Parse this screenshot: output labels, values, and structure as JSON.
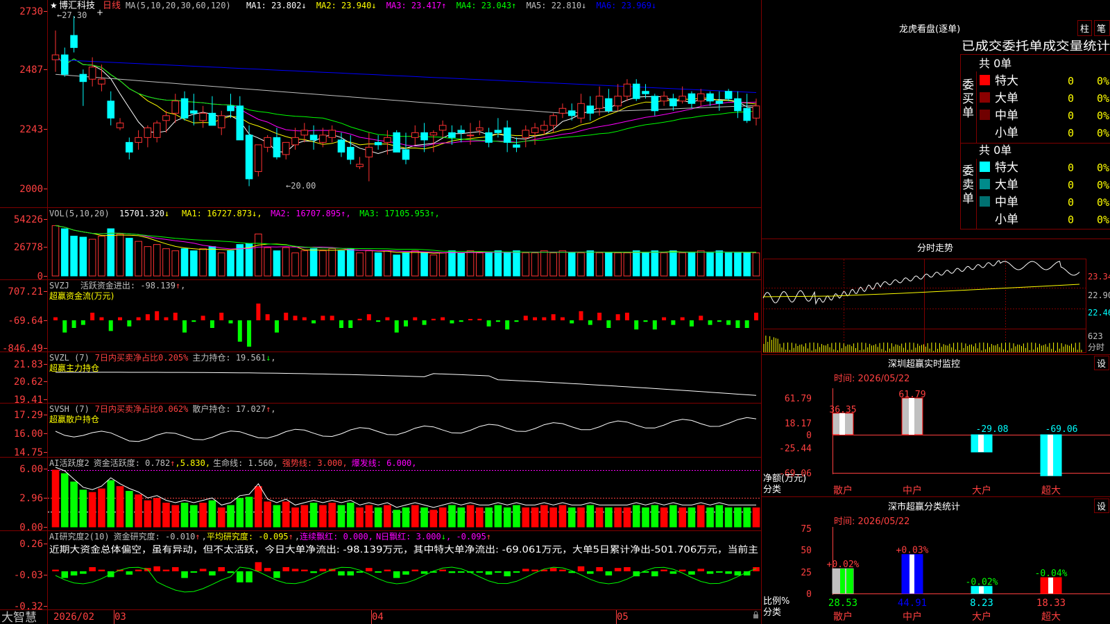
{
  "stock": {
    "name": "博汇科技",
    "period": "日线",
    "brand": "大智慧"
  },
  "main": {
    "ma_label": "MA(5,10,20,30,60,120)",
    "ma_values": [
      {
        "label": "MA1: 23.802",
        "arrow": "↓",
        "color": "#ffffff"
      },
      {
        "label": "MA2: 23.940",
        "arrow": "↓",
        "color": "#ffff00"
      },
      {
        "label": "MA3: 23.417",
        "arrow": "↑",
        "color": "#ff00ff"
      },
      {
        "label": "MA4: 23.043",
        "arrow": "↑",
        "color": "#00ff00"
      },
      {
        "label": "MA5: 22.810",
        "arrow": "↓",
        "color": "#c0c0c0"
      },
      {
        "label": "MA6: 23.969",
        "arrow": "↓",
        "color": "#0000ff"
      }
    ],
    "y_ticks": [
      "2730",
      "2487",
      "2243",
      "2000"
    ],
    "high_label": "27.30",
    "low_label": "20.00"
  },
  "vol": {
    "label": "VOL(5,10,20)",
    "value": "15701.320",
    "value_arrow": "↓",
    "ma": [
      {
        "label": "MA1: 16727.873",
        "arrow": "↓",
        "color": "#ffff00"
      },
      {
        "label": "MA2: 16707.895",
        "arrow": "↑",
        "color": "#ff00ff"
      },
      {
        "label": "MA3: 17105.953",
        "arrow": "↑",
        "color": "#00ff00"
      }
    ],
    "y_ticks": [
      "54226",
      "26778",
      "0"
    ]
  },
  "svzj": {
    "label": "SVZJ",
    "text": "活跃资金进出: -98.139",
    "arrow": "↑",
    "tail": ",",
    "sub": "超赢资金流(万元)",
    "y_ticks": [
      "707.21",
      "-69.64",
      "-846.49"
    ]
  },
  "svzl": {
    "label": "SVZL (7)",
    "ratio": "7日内买卖净占比0.205%",
    "text": "主力持仓: 19.561",
    "arrow": "↓",
    "tail": ",",
    "sub": "超赢主力持仓",
    "y_ticks": [
      "21.83",
      "20.62",
      "19.41"
    ]
  },
  "svsh": {
    "label": "SVSH (7)",
    "ratio": "7日内买卖净占比0.062%",
    "text": "散户持仓: 17.027",
    "arrow": "↑",
    "tail": ",",
    "sub": "超赢散户持仓",
    "y_ticks": [
      "17.29",
      "16.00",
      "14.75"
    ]
  },
  "ai1": {
    "label": "AI活跃度2",
    "text": "资金活跃度: 0.782",
    "a1": "↑",
    "v2": ",5.830,",
    "life": "生命线: 1.560,",
    "strong": "强势线: 3.000,",
    "burst": "爆发线: 6.000,",
    "y_ticks": [
      "6.00",
      "2.96",
      "0.00"
    ]
  },
  "ai2": {
    "label": "AI研究度2(10)",
    "text": "资金研究度: -0.010",
    "a1": "↑",
    "avg": "平均研究度: -0.095",
    "a2": "↑",
    "cont": "连续飘红: 0.000,",
    "nday": "N日飘红: 3.000",
    "a3": "↓",
    "tail": ", -0.095",
    "a4": "↑",
    "comment": "近期大资金总体偏空，虽有异动，但不太活跃，今日大单净流出: -98.139万元，其中特大单净流出: -69.061万元，大单5日累计净出-501.706万元，当前主",
    "y_ticks": [
      "0.26",
      "-0.03",
      "-0.32"
    ]
  },
  "xaxis": [
    "2026/02",
    "03",
    "04",
    "05"
  ],
  "dragon": {
    "title": "龙虎看盘(逐单)",
    "btn1": "柱",
    "btn2": "笔",
    "header": "已成交委托单成交量统计",
    "buy_label": "委买单",
    "sell_label": "委卖单",
    "buy_total": "共 0单",
    "sell_total": "共 0单",
    "buy_rows": [
      {
        "name": "特大",
        "count": "0",
        "pct": "0%",
        "color": "#ff0000"
      },
      {
        "name": "大单",
        "count": "0",
        "pct": "0%",
        "color": "#8b0000"
      },
      {
        "name": "中单",
        "count": "0",
        "pct": "0%",
        "color": "#700000"
      },
      {
        "name": "小单",
        "count": "0",
        "pct": "0%",
        "color": ""
      }
    ],
    "sell_rows": [
      {
        "name": "特大",
        "count": "0",
        "pct": "0%",
        "color": "#00ffff"
      },
      {
        "name": "大单",
        "count": "0",
        "pct": "0%",
        "color": "#008b8b"
      },
      {
        "name": "中单",
        "count": "0",
        "pct": "0%",
        "color": "#007070"
      },
      {
        "name": "小单",
        "count": "0",
        "pct": "0%",
        "color": ""
      }
    ]
  },
  "fenshi": {
    "title": "分时走势",
    "y1": "23.34",
    "y2": "22.90",
    "y3": "22.46",
    "vol": "623",
    "unit": "分时"
  },
  "sz_monitor": {
    "title": "深圳超赢实时监控",
    "btn": "设",
    "time": "时间: 2026/05/22",
    "y_ticks": [
      "61.79",
      "18.17",
      "0",
      "-25.44",
      "-69.06"
    ],
    "axis_label1": "净额(万元)",
    "axis_label2": "分类",
    "categories": [
      "散户",
      "中户",
      "大户",
      "超大"
    ],
    "values": [
      36.35,
      61.79,
      -29.08,
      -69.06
    ],
    "value_labels": [
      "36.35",
      "61.79",
      "-29.08",
      "-69.06"
    ]
  },
  "sz_class": {
    "title": "深市超赢分类统计",
    "btn": "设",
    "time": "时间: 2026/05/22",
    "y_ticks": [
      "75",
      "50",
      "25",
      "0"
    ],
    "axis_label1": "比例%",
    "axis_label2": "分类",
    "categories": [
      "散户",
      "中户",
      "大户",
      "超大"
    ],
    "values": [
      28.53,
      44.91,
      8.23,
      18.33
    ],
    "value_labels": [
      "28.53",
      "44.91",
      "8.23",
      "18.33"
    ],
    "changes": [
      "+0.02%",
      "+0.03%",
      "-0.02%",
      "-0.04%"
    ]
  },
  "chart_data": {
    "type": "candlestick",
    "ohlc": [
      [
        25.3,
        26.5,
        24.8,
        25.5
      ],
      [
        25.5,
        25.8,
        24.6,
        24.7
      ],
      [
        26.3,
        27.1,
        25.6,
        25.8
      ],
      [
        24.7,
        24.9,
        23.4,
        24.4
      ],
      [
        24.5,
        25.4,
        24.2,
        25.0
      ],
      [
        24.3,
        25.1,
        24.0,
        24.5
      ],
      [
        23.6,
        24.0,
        22.6,
        22.9
      ],
      [
        22.5,
        22.9,
        22.4,
        22.7
      ],
      [
        21.9,
        22.1,
        21.2,
        21.5
      ],
      [
        21.9,
        22.4,
        21.6,
        22.1
      ],
      [
        22.1,
        22.6,
        21.7,
        22.5
      ],
      [
        22.1,
        22.8,
        21.9,
        22.7
      ],
      [
        22.8,
        23.2,
        22.3,
        23.0
      ],
      [
        23.1,
        23.9,
        22.7,
        23.6
      ],
      [
        23.7,
        24.0,
        22.8,
        22.9
      ],
      [
        23.2,
        23.9,
        22.6,
        23.1
      ],
      [
        22.8,
        23.4,
        22.5,
        23.1
      ],
      [
        23.1,
        23.8,
        22.7,
        22.6
      ],
      [
        22.5,
        23.2,
        22.2,
        23.0
      ],
      [
        23.4,
        23.9,
        22.9,
        23.2
      ],
      [
        23.4,
        23.8,
        22.0,
        22.0
      ],
      [
        22.2,
        22.6,
        20.1,
        20.4
      ],
      [
        20.7,
        21.8,
        20.5,
        21.8
      ],
      [
        21.7,
        22.2,
        21.5,
        22.1
      ],
      [
        22.1,
        22.5,
        21.2,
        21.3
      ],
      [
        21.4,
        21.9,
        21.2,
        21.9
      ],
      [
        21.8,
        22.5,
        21.6,
        22.1
      ],
      [
        22.2,
        22.7,
        21.9,
        22.4
      ],
      [
        22.2,
        22.6,
        21.6,
        22.0
      ],
      [
        21.9,
        22.5,
        21.7,
        22.2
      ],
      [
        22.1,
        22.6,
        21.9,
        22.4
      ],
      [
        22.0,
        22.3,
        21.3,
        21.5
      ],
      [
        21.7,
        22.2,
        21.0,
        21.2
      ],
      [
        20.9,
        21.3,
        20.8,
        21.0
      ],
      [
        21.3,
        22.3,
        20.3,
        21.7
      ],
      [
        21.9,
        22.2,
        21.6,
        21.8
      ],
      [
        21.9,
        22.4,
        21.4,
        22.1
      ],
      [
        22.3,
        22.4,
        21.5,
        21.5
      ],
      [
        21.6,
        22.3,
        21.0,
        21.2
      ],
      [
        22.1,
        22.6,
        21.8,
        22.3
      ],
      [
        22.3,
        22.7,
        21.5,
        22.0
      ],
      [
        22.2,
        22.4,
        21.5,
        22.3
      ],
      [
        22.4,
        22.8,
        22.1,
        22.6
      ],
      [
        22.3,
        22.6,
        21.8,
        22.1
      ],
      [
        22.4,
        22.6,
        21.9,
        22.3
      ],
      [
        22.2,
        22.7,
        21.8,
        22.2
      ],
      [
        22.4,
        22.8,
        22.2,
        22.5
      ],
      [
        22.3,
        22.5,
        21.7,
        21.9
      ],
      [
        22.4,
        22.9,
        22.1,
        22.3
      ],
      [
        22.5,
        22.8,
        21.5,
        21.9
      ],
      [
        21.8,
        22.1,
        21.5,
        21.7
      ],
      [
        22.1,
        22.6,
        21.7,
        22.4
      ],
      [
        22.3,
        22.7,
        21.8,
        22.5
      ],
      [
        22.4,
        22.8,
        22.2,
        22.6
      ],
      [
        22.6,
        23.1,
        22.3,
        23.0
      ],
      [
        23.1,
        23.5,
        22.9,
        23.3
      ],
      [
        23.2,
        23.5,
        22.8,
        23.0
      ],
      [
        22.9,
        23.9,
        22.7,
        23.5
      ],
      [
        23.4,
        23.8,
        22.8,
        23.1
      ],
      [
        23.3,
        24.2,
        23.0,
        23.8
      ],
      [
        23.7,
        24.1,
        23.1,
        23.2
      ],
      [
        23.4,
        24.3,
        23.2,
        23.8
      ],
      [
        23.8,
        24.5,
        23.6,
        24.3
      ],
      [
        24.3,
        24.5,
        23.6,
        23.7
      ],
      [
        24.0,
        24.3,
        23.7,
        23.9
      ],
      [
        23.8,
        23.9,
        23.0,
        23.2
      ],
      [
        23.6,
        24.0,
        23.4,
        23.8
      ],
      [
        23.7,
        23.9,
        23.2,
        23.4
      ],
      [
        23.6,
        24.2,
        23.5,
        23.8
      ],
      [
        23.9,
        24.0,
        23.3,
        23.5
      ],
      [
        23.6,
        24.1,
        23.4,
        23.9
      ],
      [
        23.9,
        24.0,
        23.4,
        23.6
      ],
      [
        23.6,
        24.0,
        23.2,
        23.5
      ],
      [
        24.0,
        24.1,
        23.6,
        23.7
      ],
      [
        23.7,
        24.0,
        22.9,
        23.2
      ],
      [
        23.3,
        23.9,
        22.7,
        22.8
      ],
      [
        22.9,
        23.7,
        22.6,
        23.4
      ]
    ],
    "ylim": [
      20.0,
      27.3
    ],
    "volume": [
      48000,
      45000,
      38000,
      37000,
      35000,
      38000,
      45000,
      40000,
      36000,
      33000,
      28000,
      30000,
      26000,
      24000,
      26000,
      24000,
      26000,
      28000,
      22000,
      24000,
      30000,
      31000,
      40000,
      27000,
      24000,
      27000,
      22000,
      24000,
      26000,
      24000,
      26000,
      24000,
      26000,
      22000,
      24000,
      22000,
      24000,
      20000,
      22000,
      24000,
      22000,
      20000,
      22000,
      24000,
      22000,
      24000,
      22000,
      22000,
      24000,
      22000,
      24000,
      22000,
      22000,
      24000,
      22000,
      24000,
      22000,
      22000,
      24000,
      22000,
      22000,
      22000,
      22000,
      24000,
      22000,
      24000,
      22000,
      24000,
      22000,
      22000,
      24000,
      22000,
      24000,
      22000,
      22000,
      22000,
      22000
    ],
    "vol_ylim": [
      0,
      54226
    ]
  }
}
